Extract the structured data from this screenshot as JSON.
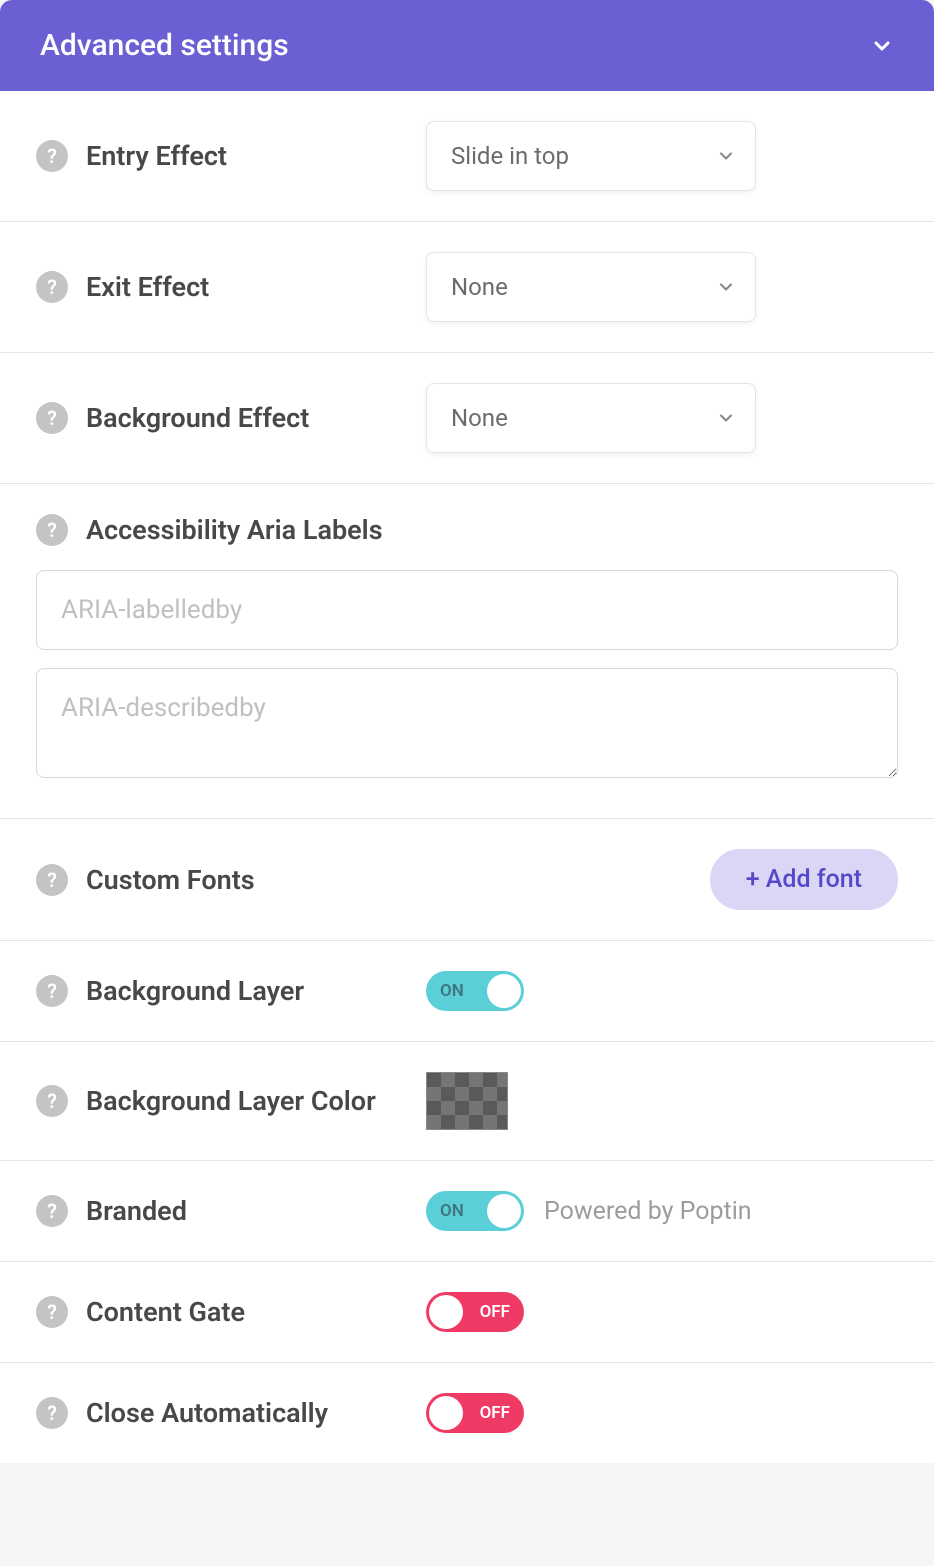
{
  "header": {
    "title": "Advanced settings"
  },
  "labels": {
    "entryEffect": "Entry Effect",
    "exitEffect": "Exit Effect",
    "backgroundEffect": "Background Effect",
    "accessibilityAria": "Accessibility Aria Labels",
    "customFonts": "Custom Fonts",
    "backgroundLayer": "Background Layer",
    "backgroundLayerColor": "Background Layer Color",
    "branded": "Branded",
    "contentGate": "Content Gate",
    "closeAutomatically": "Close Automatically"
  },
  "values": {
    "entryEffect": "Slide in top",
    "exitEffect": "None",
    "backgroundEffect": "None"
  },
  "placeholders": {
    "ariaLabelledby": "ARIA-labelledby",
    "ariaDescribedby": "ARIA-describedby"
  },
  "buttons": {
    "addFont": "+ Add font"
  },
  "toggleLabels": {
    "on": "ON",
    "off": "OFF"
  },
  "text": {
    "brandedBy": "Powered by Poptin",
    "helpIcon": "?"
  },
  "toggles": {
    "backgroundLayer": true,
    "branded": true,
    "contentGate": false,
    "closeAutomatically": false
  }
}
